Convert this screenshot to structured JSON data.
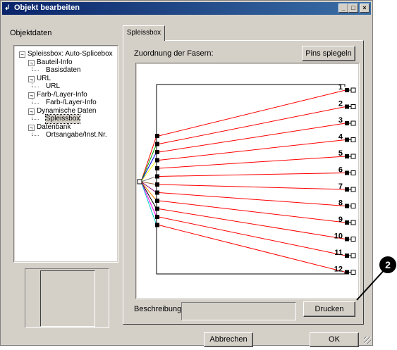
{
  "window": {
    "title": "Objekt bearbeiten",
    "controls": [
      "_",
      "□",
      "×"
    ]
  },
  "left": {
    "group_label": "Objektdaten",
    "tree": [
      {
        "label": "Spleissbox: Auto-Splicebox",
        "expander": "−"
      },
      {
        "label": "Bauteil-Info",
        "expander": "−"
      },
      {
        "label": "Basisdaten"
      },
      {
        "label": "URL",
        "expander": "−"
      },
      {
        "label": "URL"
      },
      {
        "label": "Farb-/Layer-Info",
        "expander": "−"
      },
      {
        "label": "Farb-/Layer-Info"
      },
      {
        "label": "Dynamische Daten",
        "expander": "−"
      },
      {
        "label": "Spleissbox",
        "selected": true
      },
      {
        "label": "Datenbank",
        "expander": "−"
      },
      {
        "label": "Ortsangabe/Inst.Nr."
      }
    ]
  },
  "tab": {
    "label": "Spleissbox"
  },
  "splice": {
    "heading": "Zuordnung der Fasern:",
    "mirror_button": "Pins spiegeln",
    "pins": [
      "1",
      "2",
      "3",
      "4",
      "5",
      "6",
      "7",
      "8",
      "9",
      "10",
      "11",
      "12"
    ],
    "left_fiber_colors": [
      "#ff0000",
      "#00aa00",
      "#0000ff",
      "#ffff00",
      "#ffffff",
      "#808080",
      "#996633",
      "#800080",
      "#ff8800",
      "#000000",
      "#ff00ff",
      "#00cccc"
    ],
    "line_color": "#ff0000"
  },
  "description": {
    "label": "Beschreibung:",
    "value": ""
  },
  "print_button": "Drucken",
  "footer": {
    "cancel": "Abbrechen",
    "ok": "OK"
  },
  "callout": {
    "number": "2"
  }
}
